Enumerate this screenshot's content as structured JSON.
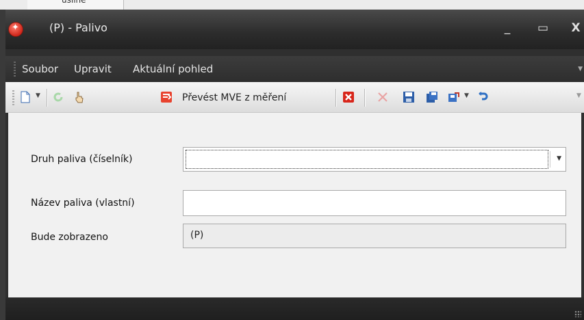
{
  "background": {
    "peek_text": "usline"
  },
  "window": {
    "title": "(P) - Palivo",
    "buttons": {
      "minimize": "_",
      "maximize": "▭",
      "close": "X"
    }
  },
  "menu": {
    "items": [
      "Soubor",
      "Upravit",
      "Aktuální pohled"
    ]
  },
  "toolbar": {
    "prevest_label": "Převést MVE z měření"
  },
  "form": {
    "fuel_type_label": "Druh paliva (číselník)",
    "fuel_type_value": "",
    "fuel_name_label": "Název paliva (vlastní)",
    "fuel_name_value": "",
    "display_label": "Bude zobrazeno",
    "display_value": "(P)"
  },
  "colors": {
    "close_red": "#d0261b",
    "title_bar": "#2c2c2c",
    "content_bg": "#f1f1f1"
  }
}
